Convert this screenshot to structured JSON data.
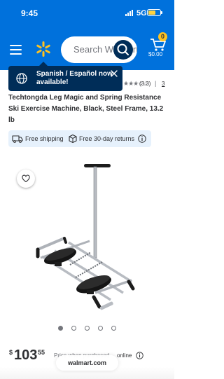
{
  "status_bar": {
    "time": "9:45",
    "network": "5G"
  },
  "header": {
    "search_placeholder": "Search Walmart",
    "cart_count": "0",
    "cart_total": "$0.00",
    "brand_color": "#0071dc",
    "spark_color": "#ffc220"
  },
  "language_banner": {
    "text": "Spanish / Español now available!",
    "icons": [
      "globe-icon",
      "close-icon"
    ]
  },
  "rating": {
    "stars": "★★★☆☆",
    "value": "(3.3)",
    "separator": "|",
    "reviews_fragment": "3"
  },
  "product": {
    "title": "Techtongda Leg Magic and Spring Resistance Ski Exercise Machine, Black, Steel Frame, 13.2 lb",
    "image_count": 5,
    "active_image": 1
  },
  "fulfillment": {
    "shipping_label": "Free shipping",
    "returns_label": "Free 30-day returns"
  },
  "price": {
    "symbol": "$",
    "whole": "103",
    "cents": "55",
    "note": "Price when purchased",
    "online_label": "online"
  },
  "browser": {
    "url": "walmart.com"
  }
}
